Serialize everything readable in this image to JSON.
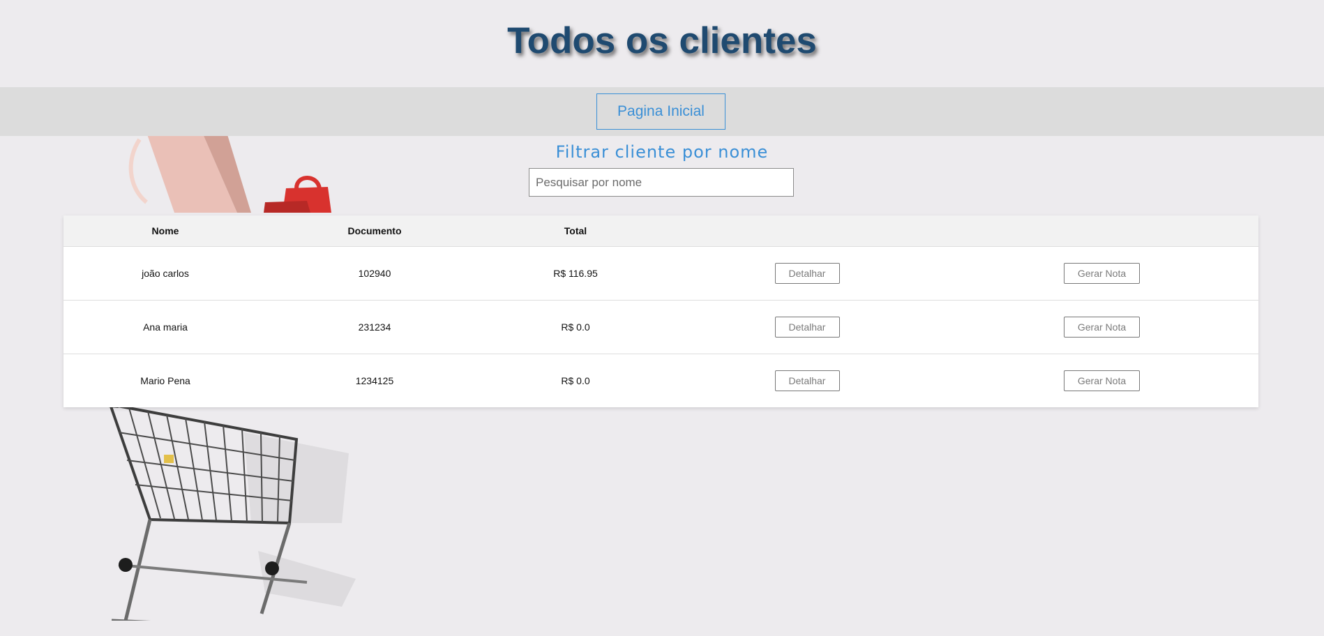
{
  "header": {
    "title": "Todos os clientes"
  },
  "nav": {
    "home_label": "Pagina Inicial"
  },
  "filter": {
    "title": "Filtrar cliente por nome",
    "placeholder": "Pesquisar por nome",
    "value": ""
  },
  "table": {
    "columns": [
      "Nome",
      "Documento",
      "Total",
      "",
      ""
    ],
    "rows": [
      {
        "nome": "joão carlos",
        "documento": "102940",
        "total": "R$ 116.95",
        "detail_label": "Detalhar",
        "invoice_label": "Gerar Nota"
      },
      {
        "nome": "Ana maria",
        "documento": "231234",
        "total": "R$ 0.0",
        "detail_label": "Detalhar",
        "invoice_label": "Gerar Nota"
      },
      {
        "nome": "Mario Pena",
        "documento": "1234125",
        "total": "R$ 0.0",
        "detail_label": "Detalhar",
        "invoice_label": "Gerar Nota"
      }
    ]
  },
  "colors": {
    "accent": "#3a8fd6",
    "title": "#1f4a70",
    "nav_band": "#dcdcdc",
    "page_bg": "#edebee"
  },
  "background_image": {
    "subject": "shopping-cart-and-bags-icon"
  }
}
